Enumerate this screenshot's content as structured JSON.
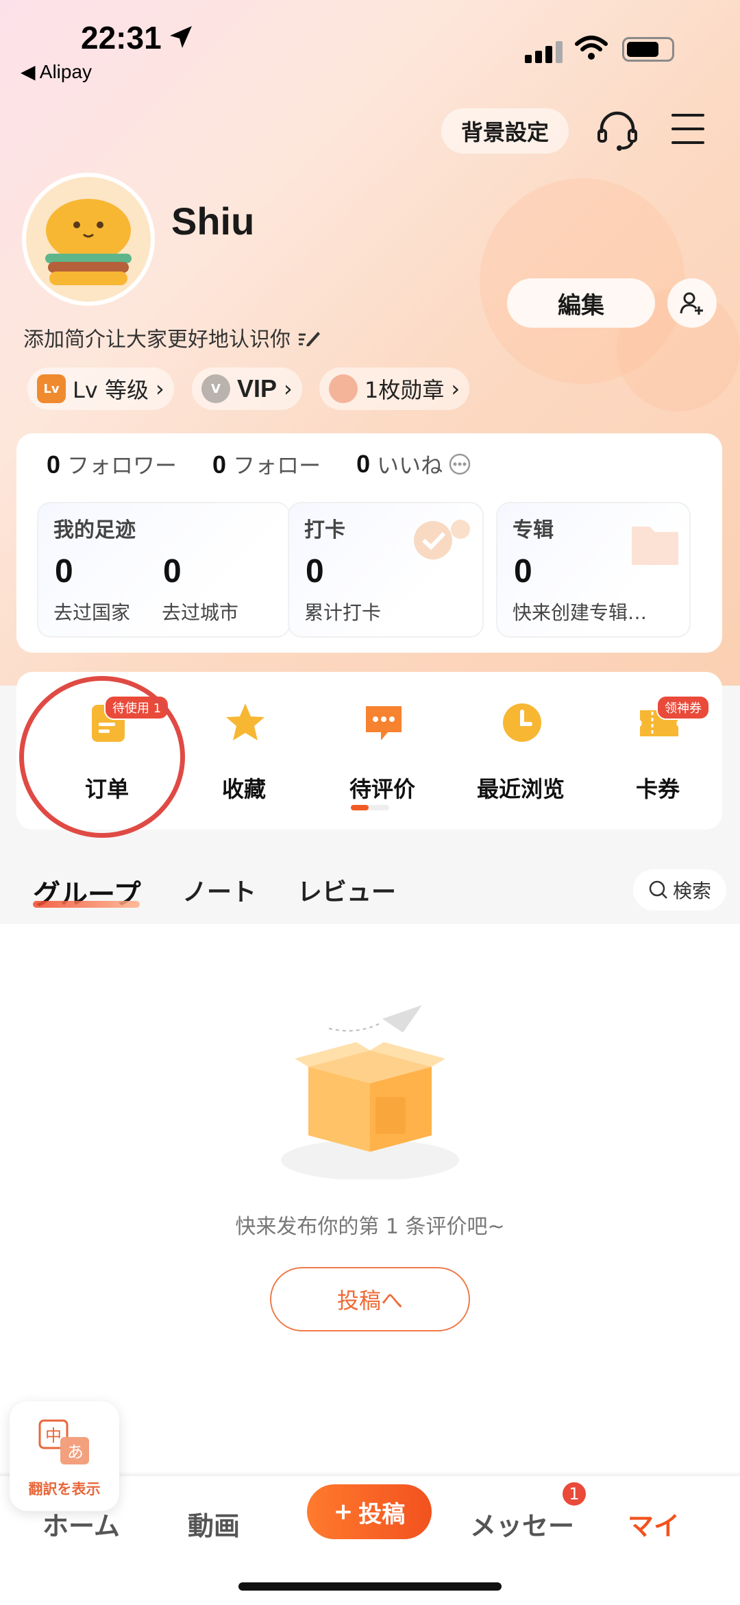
{
  "status_bar": {
    "time": "22:31",
    "back_app": "◀ Alipay"
  },
  "header": {
    "background_setting": "背景設定",
    "icons": [
      "headset-icon",
      "menu-icon"
    ]
  },
  "profile": {
    "username": "Shiu",
    "edit_label": "編集",
    "bio": "添加简介让大家更好地认识你",
    "chips": [
      {
        "badge": "Lv",
        "label": "Lv 等级"
      },
      {
        "badge": "V",
        "label": "VIP"
      },
      {
        "badge": "",
        "label": "1枚勋章"
      }
    ]
  },
  "stats": {
    "followers": {
      "count": "0",
      "label": "フォロワー"
    },
    "following": {
      "count": "0",
      "label": "フォロー"
    },
    "likes": {
      "count": "0",
      "label": "いいね"
    },
    "cards": [
      {
        "title": "我的足迹",
        "items": [
          {
            "num": "0",
            "label": "去过国家"
          },
          {
            "num": "0",
            "label": "去过城市"
          }
        ]
      },
      {
        "title": "打卡",
        "items": [
          {
            "num": "0",
            "label": "累计打卡"
          }
        ]
      },
      {
        "title": "专辑",
        "items": [
          {
            "num": "0",
            "label": "快来创建专辑…"
          }
        ]
      }
    ]
  },
  "actions": [
    {
      "label": "订单",
      "badge": "待使用 1",
      "icon": "order-icon"
    },
    {
      "label": "收藏",
      "icon": "star-icon"
    },
    {
      "label": "待评价",
      "icon": "comment-icon"
    },
    {
      "label": "最近浏览",
      "icon": "clock-icon"
    },
    {
      "label": "卡券",
      "badge": "领神券",
      "icon": "coupon-icon"
    }
  ],
  "tabs": [
    "グループ",
    "ノート",
    "レビュー"
  ],
  "search_label": "検索",
  "empty_state": {
    "message": "快来发布你的第 1 条评价吧~",
    "button": "投稿へ"
  },
  "translate_widget": {
    "label": "翻訳を表示"
  },
  "bottom_nav": {
    "home": "ホーム",
    "video": "動画",
    "post": "投稿",
    "message": "メッセー",
    "message_badge": "1",
    "mine": "マイ"
  },
  "colors": {
    "accent": "#f2521e",
    "badge_red": "#e94a3a",
    "highlight_circle": "#e04a44"
  }
}
